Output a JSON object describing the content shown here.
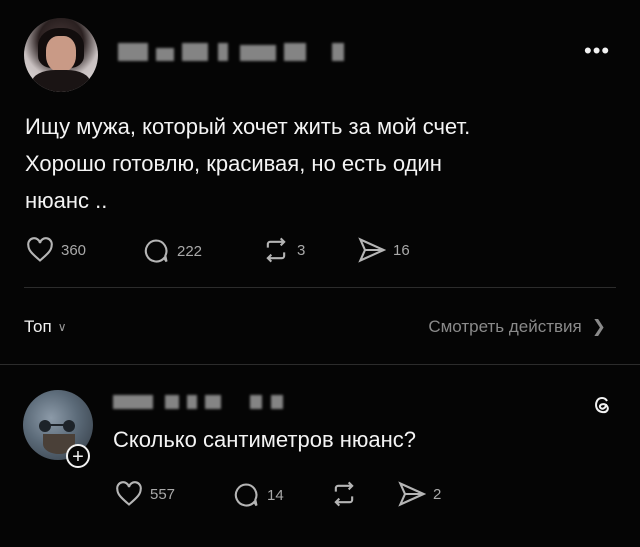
{
  "post": {
    "text_line1": "Ищу мужа, который хочет жить за мой счет.",
    "text_line2": "Хорошо готовлю, красивая, но есть один",
    "text_line3": "нюанс ..",
    "actions": {
      "likes": "360",
      "comments": "222",
      "reposts": "3",
      "shares": "16"
    },
    "more_icon": "more-dots-icon"
  },
  "filter": {
    "sort_label": "Топ",
    "activity_label": "Смотреть действия"
  },
  "reply": {
    "text": "Сколько сантиметров нюанс?",
    "actions": {
      "likes": "557",
      "comments": "14",
      "shares": "2"
    }
  },
  "icons": {
    "like": "heart-icon",
    "comment": "comment-icon",
    "repost": "repost-icon",
    "share": "share-icon",
    "threads": "threads-logo-icon"
  }
}
